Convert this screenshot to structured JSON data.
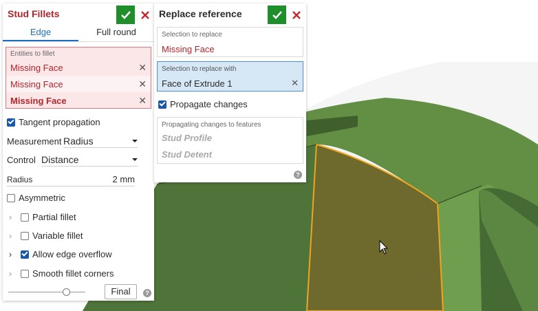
{
  "stud_fillets": {
    "title": "Stud Fillets",
    "tabs": [
      {
        "label": "Edge"
      },
      {
        "label": "Full round"
      }
    ],
    "entities_caption": "Entities to fillet",
    "entities": [
      {
        "label": "Missing Face"
      },
      {
        "label": "Missing Face"
      },
      {
        "label": "Missing Face"
      }
    ],
    "tangent_propagation_label": "Tangent propagation",
    "measurement_label": "Measurement",
    "measurement_value": "Radius",
    "control_label": "Control",
    "control_value": "Distance",
    "radius_label": "Radius",
    "radius_value": "2 mm",
    "asymmetric_label": "Asymmetric",
    "partial_fillet_label": "Partial fillet",
    "variable_fillet_label": "Variable fillet",
    "allow_edge_overflow_label": "Allow edge overflow",
    "smooth_corners_label": "Smooth fillet corners",
    "final_label": "Final",
    "slider_fraction": 0.75,
    "tangent_propagation_checked": true,
    "asymmetric_checked": false,
    "partial_fillet_checked": false,
    "variable_fillet_checked": false,
    "allow_edge_overflow_checked": true,
    "smooth_corners_checked": false
  },
  "replace_reference": {
    "title": "Replace reference",
    "selection_to_replace_caption": "Selection to replace",
    "selection_to_replace_value": "Missing Face",
    "replace_with_caption": "Selection to replace with",
    "replace_with_value": "Face of Extrude 1",
    "propagate_label": "Propagate changes",
    "propagate_checked": true,
    "propagating_caption": "Propagating changes to features",
    "features": [
      {
        "label": "Stud Profile"
      },
      {
        "label": "Stud Detent"
      }
    ]
  },
  "icons": {
    "ok": "checkmark-icon",
    "cancel": "close-icon",
    "help": "help-icon",
    "cursor": "mouse-cursor-icon"
  },
  "colors": {
    "accent_red": "#b3242b",
    "ok_green": "#1f8f2c",
    "tab_blue": "#1b6fc2",
    "model_green": "#6f9e4f",
    "highlight_face": "#6e6a2e",
    "highlight_edge": "#f2a41e"
  }
}
